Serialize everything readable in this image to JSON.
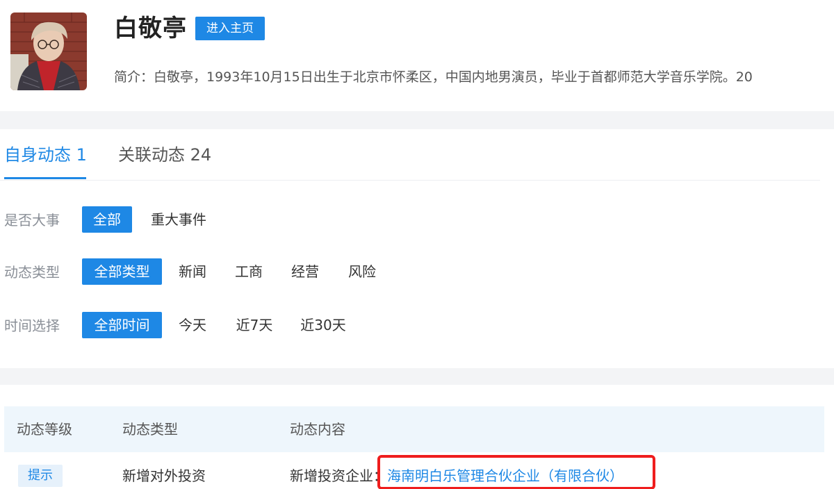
{
  "profile": {
    "name": "白敬亭",
    "home_button": "进入主页",
    "intro": "简介：白敬亭，1993年10月15日出生于北京市怀柔区，中国内地男演员，毕业于首都师范大学音乐学院。20"
  },
  "tabs": [
    {
      "label": "自身动态 1",
      "active": true
    },
    {
      "label": "关联动态 24",
      "active": false
    }
  ],
  "filters": {
    "major": {
      "label": "是否大事",
      "options": [
        "全部",
        "重大事件"
      ],
      "selected": "全部"
    },
    "type": {
      "label": "动态类型",
      "options": [
        "全部类型",
        "新闻",
        "工商",
        "经营",
        "风险"
      ],
      "selected": "全部类型"
    },
    "time": {
      "label": "时间选择",
      "options": [
        "全部时间",
        "今天",
        "近7天",
        "近30天"
      ],
      "selected": "全部时间"
    }
  },
  "table": {
    "headers": [
      "动态等级",
      "动态类型",
      "动态内容"
    ],
    "rows": [
      {
        "level": "提示",
        "type": "新增对外投资",
        "content_prefix": "新增投资企业：",
        "content_link": "海南明白乐管理合伙企业（有限合伙）"
      }
    ]
  },
  "colors": {
    "accent": "#1e88e5",
    "highlight": "#ef1d1d",
    "band": "#f3f4f6",
    "table_header_bg": "#eef6fc"
  }
}
